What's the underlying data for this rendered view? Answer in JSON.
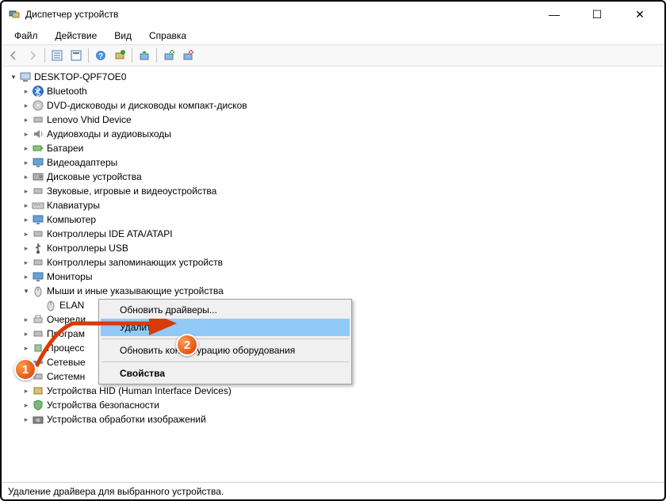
{
  "window": {
    "title": "Диспетчер устройств",
    "minimize": "—",
    "maximize": "☐",
    "close": "✕"
  },
  "menu": {
    "file": "Файл",
    "action": "Действие",
    "view": "Вид",
    "help": "Справка"
  },
  "tree": {
    "root": "DESKTOP-QPF7OE0",
    "items": [
      "Bluetooth",
      "DVD-дисководы и дисководы компакт-дисков",
      "Lenovo Vhid Device",
      "Аудиовходы и аудиовыходы",
      "Батареи",
      "Видеоадаптеры",
      "Дисковые устройства",
      "Звуковые, игровые и видеоустройства",
      "Клавиатуры",
      "Компьютер",
      "Контроллеры IDE ATA/ATAPI",
      "Контроллеры USB",
      "Контроллеры запоминающих устройств",
      "Мониторы"
    ],
    "mice_label": "Мыши и иные указывающие устройства",
    "mice_child": "ELAN",
    "after": [
      "Очереди",
      "Програм",
      "Процесс",
      "Сетевые",
      "Системн"
    ],
    "tail": [
      "Устройства HID (Human Interface Devices)",
      "Устройства безопасности",
      "Устройства обработки изображений"
    ]
  },
  "context_menu": {
    "update": "Обновить драйверы...",
    "delete": "Удалить",
    "scan": "Обновить конфигурацию оборудования",
    "props": "Свойства"
  },
  "statusbar": "Удаление драйвера для выбранного устройства.",
  "markers": {
    "m1": "1",
    "m2": "2"
  },
  "icons": {
    "pc": "computer",
    "bt": "bluetooth",
    "dvd": "disc",
    "len": "device",
    "audio": "audio",
    "bat": "battery",
    "video": "display",
    "disk": "disk",
    "sound": "sound",
    "kb": "keyboard",
    "comp": "monitor",
    "ide": "ide",
    "usb": "usb",
    "stor": "storage",
    "mon": "monitor",
    "mouse": "mouse",
    "queue": "printer",
    "prog": "app",
    "cpu": "cpu",
    "net": "network",
    "sys": "system",
    "hid": "hid",
    "sec": "security",
    "img": "camera"
  }
}
